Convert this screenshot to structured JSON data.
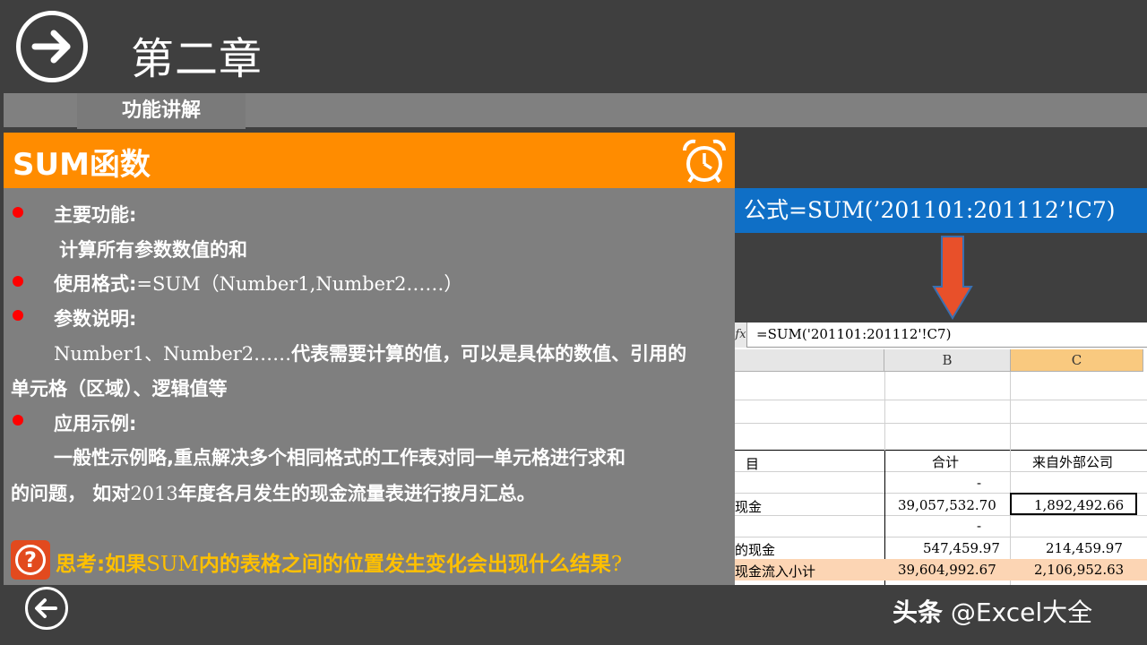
{
  "chapter_title": "第二章",
  "band_label": "功能讲解",
  "function_title": "SUM函数",
  "content": {
    "main_function_label": "主要功能:",
    "main_function_text": "计算所有参数数值的和",
    "usage_label": "使用格式:",
    "usage_text": "=SUM（Number1,Number2……）",
    "params_label": "参数说明:",
    "params_text_1_a": "Number1、Number2……",
    "params_text_1_b": "代表需要计算的值，可以是具体的数值、引用的",
    "params_text_2": "单元格（区域）、逻辑值等",
    "example_label": "应用示例:",
    "example_text_1": "一般性示例略,重点解决多个相同格式的工作表对同一单元格进行求和",
    "example_text_2_a": "的问题，  如对",
    "example_text_2_b": "2013",
    "example_text_2_c": "年度各月发生的现金流量表进行按月汇总。",
    "think_text_a": "思考:如果",
    "think_text_b": "SUM",
    "think_text_c": "内的表格之间的位置发生变化会出现什么结果",
    "think_text_d": "?"
  },
  "formula_caption": "公式=SUM(’201101:201112’!C7)",
  "spreadsheet": {
    "formula_bar": "=SUM('201101:201112'!C7)",
    "col_b": "B",
    "col_c": "C",
    "header_a": "目",
    "header_b": "合计",
    "header_c": "来自外部公司",
    "row1_b": "-",
    "row2_a": "现金",
    "row2_b": "39,057,532.70",
    "row2_c": "1,892,492.66",
    "row3_b": "-",
    "row4_a": "的现金",
    "row4_b": "547,459.97",
    "row4_c": "214,459.97",
    "row5_a": "现金流入小计",
    "row5_b": "39,604,992.67",
    "row5_c": "2,106,952.63"
  },
  "watermark": {
    "brand": "头条",
    "handle": "@Excel大全"
  },
  "colors": {
    "orange": "#ff8c00",
    "blue": "#0f6fc6",
    "bullet_red": "#ff0000",
    "think_yellow": "#ffc000",
    "arrow_red": "#e8502a"
  }
}
